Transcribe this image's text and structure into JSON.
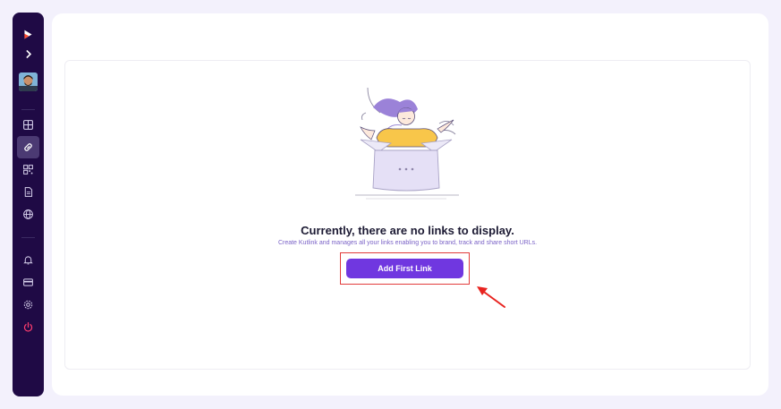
{
  "sidebar": {
    "logo_icon": "brand-logo-icon",
    "expand_icon": "chevron-right-icon",
    "nav_items": [
      {
        "icon": "dashboard-grid-icon",
        "active": false
      },
      {
        "icon": "link-icon",
        "active": true
      },
      {
        "icon": "qr-code-icon",
        "active": false
      },
      {
        "icon": "document-icon",
        "active": false
      },
      {
        "icon": "globe-icon",
        "active": false
      }
    ],
    "bottom_items": [
      {
        "icon": "bell-icon"
      },
      {
        "icon": "credit-card-icon"
      },
      {
        "icon": "settings-gear-icon"
      },
      {
        "icon": "power-icon"
      }
    ]
  },
  "empty_state": {
    "title": "Currently, there are no links to display.",
    "subtitle": "Create Kutlink and manages all your links enabling you to brand, track and share short URLs.",
    "button_label": "Add First Link"
  },
  "colors": {
    "sidebar_bg": "#1f0a45",
    "accent": "#7037e0",
    "annotation_red": "#e23c3c",
    "power_icon": "#ff3d6e"
  }
}
